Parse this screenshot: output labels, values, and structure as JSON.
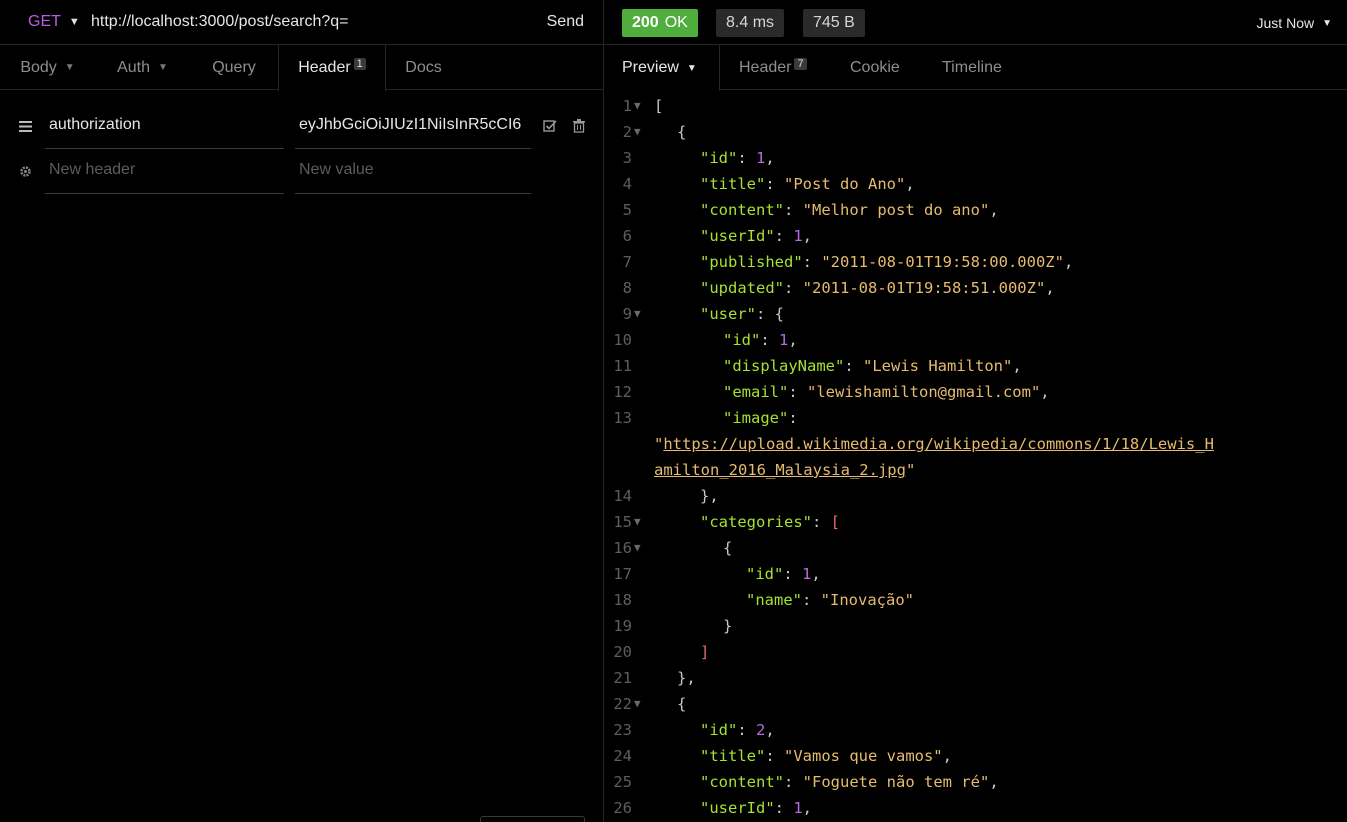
{
  "request": {
    "method": "GET",
    "url": "http://localhost:3000/post/search?q=",
    "send_label": "Send",
    "tabs": [
      {
        "label": "Body",
        "caret": true
      },
      {
        "label": "Auth",
        "caret": true
      },
      {
        "label": "Query",
        "caret": false
      },
      {
        "label": "Header",
        "badge": "1",
        "active": true
      },
      {
        "label": "Docs",
        "caret": false
      }
    ],
    "headers": [
      {
        "name": "authorization",
        "value": "eyJhbGciOiJIUzI1NiIsInR5cCI6"
      }
    ],
    "new_header_placeholder": "New header",
    "new_value_placeholder": "New value"
  },
  "response": {
    "status_code": "200",
    "status_text": "OK",
    "time": "8.4 ms",
    "size": "745 B",
    "history_label": "Just Now",
    "tabs": [
      {
        "label": "Preview",
        "caret": true,
        "active": true
      },
      {
        "label": "Header",
        "badge": "7"
      },
      {
        "label": "Cookie"
      },
      {
        "label": "Timeline"
      }
    ],
    "lines": [
      {
        "n": "1",
        "fold": true,
        "indent": 0,
        "parts": [
          [
            "br",
            "["
          ]
        ]
      },
      {
        "n": "2",
        "fold": true,
        "indent": 1,
        "parts": [
          [
            "br",
            "{"
          ]
        ]
      },
      {
        "n": "3",
        "indent": 2,
        "parts": [
          [
            "k",
            "\"id\""
          ],
          [
            "p",
            ": "
          ],
          [
            "n",
            "1"
          ],
          [
            "p",
            ","
          ]
        ]
      },
      {
        "n": "4",
        "indent": 2,
        "parts": [
          [
            "k",
            "\"title\""
          ],
          [
            "p",
            ": "
          ],
          [
            "s",
            "\"Post do Ano\""
          ],
          [
            "p",
            ","
          ]
        ]
      },
      {
        "n": "5",
        "indent": 2,
        "parts": [
          [
            "k",
            "\"content\""
          ],
          [
            "p",
            ": "
          ],
          [
            "s",
            "\"Melhor post do ano\""
          ],
          [
            "p",
            ","
          ]
        ]
      },
      {
        "n": "6",
        "indent": 2,
        "parts": [
          [
            "k",
            "\"userId\""
          ],
          [
            "p",
            ": "
          ],
          [
            "n",
            "1"
          ],
          [
            "p",
            ","
          ]
        ]
      },
      {
        "n": "7",
        "indent": 2,
        "parts": [
          [
            "k",
            "\"published\""
          ],
          [
            "p",
            ": "
          ],
          [
            "s",
            "\"2011-08-01T19:58:00.000Z\""
          ],
          [
            "p",
            ","
          ]
        ]
      },
      {
        "n": "8",
        "indent": 2,
        "parts": [
          [
            "k",
            "\"updated\""
          ],
          [
            "p",
            ": "
          ],
          [
            "s",
            "\"2011-08-01T19:58:51.000Z\""
          ],
          [
            "p",
            ","
          ]
        ]
      },
      {
        "n": "9",
        "fold": true,
        "indent": 2,
        "parts": [
          [
            "k",
            "\"user\""
          ],
          [
            "p",
            ": "
          ],
          [
            "br",
            "{"
          ]
        ]
      },
      {
        "n": "10",
        "indent": 3,
        "parts": [
          [
            "k",
            "\"id\""
          ],
          [
            "p",
            ": "
          ],
          [
            "n",
            "1"
          ],
          [
            "p",
            ","
          ]
        ]
      },
      {
        "n": "11",
        "indent": 3,
        "parts": [
          [
            "k",
            "\"displayName\""
          ],
          [
            "p",
            ": "
          ],
          [
            "s",
            "\"Lewis Hamilton\""
          ],
          [
            "p",
            ","
          ]
        ]
      },
      {
        "n": "12",
        "indent": 3,
        "parts": [
          [
            "k",
            "\"email\""
          ],
          [
            "p",
            ": "
          ],
          [
            "s",
            "\"lewishamilton@gmail.com\""
          ],
          [
            "p",
            ","
          ]
        ]
      },
      {
        "n": "13",
        "indent": 3,
        "parts": [
          [
            "k",
            "\"image\""
          ],
          [
            "p",
            ":"
          ]
        ]
      },
      {
        "n": "",
        "indent": 0,
        "parts": [
          [
            "s",
            "\""
          ],
          [
            "u",
            "https://upload.wikimedia.org/wikipedia/commons/1/18/Lewis_H"
          ]
        ]
      },
      {
        "n": "",
        "indent": 0,
        "parts": [
          [
            "u",
            "amilton_2016_Malaysia_2.jpg"
          ],
          [
            "s",
            "\""
          ]
        ]
      },
      {
        "n": "14",
        "indent": 2,
        "parts": [
          [
            "br",
            "},"
          ]
        ]
      },
      {
        "n": "15",
        "fold": true,
        "indent": 2,
        "parts": [
          [
            "k",
            "\"categories\""
          ],
          [
            "p",
            ": "
          ],
          [
            "sbr",
            "["
          ]
        ]
      },
      {
        "n": "16",
        "fold": true,
        "indent": 3,
        "parts": [
          [
            "br",
            "{"
          ]
        ]
      },
      {
        "n": "17",
        "indent": 4,
        "parts": [
          [
            "k",
            "\"id\""
          ],
          [
            "p",
            ": "
          ],
          [
            "n",
            "1"
          ],
          [
            "p",
            ","
          ]
        ]
      },
      {
        "n": "18",
        "indent": 4,
        "parts": [
          [
            "k",
            "\"name\""
          ],
          [
            "p",
            ": "
          ],
          [
            "s",
            "\"Inovação\""
          ]
        ]
      },
      {
        "n": "19",
        "indent": 3,
        "parts": [
          [
            "br",
            "}"
          ]
        ]
      },
      {
        "n": "20",
        "indent": 2,
        "parts": [
          [
            "sbr",
            "]"
          ]
        ]
      },
      {
        "n": "21",
        "indent": 1,
        "parts": [
          [
            "br",
            "},"
          ]
        ]
      },
      {
        "n": "22",
        "fold": true,
        "indent": 1,
        "parts": [
          [
            "br",
            "{"
          ]
        ]
      },
      {
        "n": "23",
        "indent": 2,
        "parts": [
          [
            "k",
            "\"id\""
          ],
          [
            "p",
            ": "
          ],
          [
            "n",
            "2"
          ],
          [
            "p",
            ","
          ]
        ]
      },
      {
        "n": "24",
        "indent": 2,
        "parts": [
          [
            "k",
            "\"title\""
          ],
          [
            "p",
            ": "
          ],
          [
            "s",
            "\"Vamos que vamos\""
          ],
          [
            "p",
            ","
          ]
        ]
      },
      {
        "n": "25",
        "indent": 2,
        "parts": [
          [
            "k",
            "\"content\""
          ],
          [
            "p",
            ": "
          ],
          [
            "s",
            "\"Foguete não tem ré\""
          ],
          [
            "p",
            ","
          ]
        ]
      },
      {
        "n": "26",
        "indent": 2,
        "parts": [
          [
            "k",
            "\"userId\""
          ],
          [
            "p",
            ": "
          ],
          [
            "n",
            "1"
          ],
          [
            "p",
            ","
          ]
        ]
      }
    ]
  },
  "colors": {
    "method": "#b95ee0",
    "status_ok": "#4fae3c",
    "json_key": "#a6e22e",
    "json_string": "#e6bb6e",
    "json_number": "#b36ae2"
  }
}
